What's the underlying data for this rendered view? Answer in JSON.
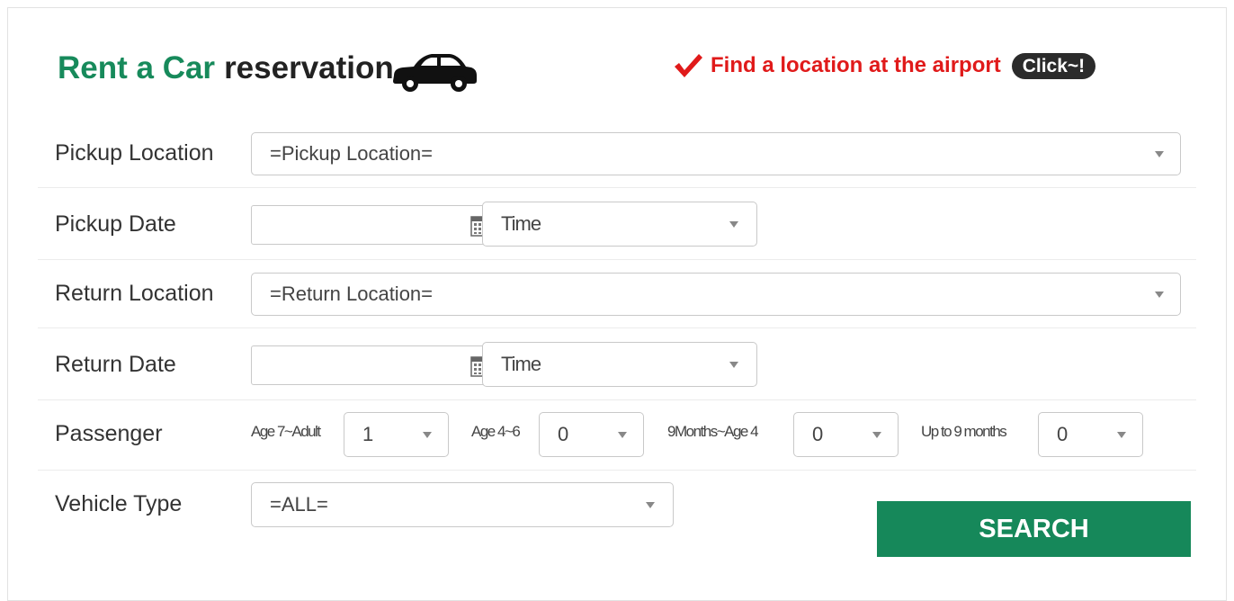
{
  "header": {
    "title_green": "Rent a Car",
    "title_dark": "reservation",
    "car_icon": "car-icon",
    "airport_link": "Find a location at the airport",
    "click_label": "Click~!",
    "check_icon": "checkmark-icon"
  },
  "colors": {
    "brand_green": "#178a5b",
    "alert_red": "#e01a1a",
    "button_green": "#16885a"
  },
  "form": {
    "pickup_location": {
      "label": "Pickup Location",
      "value": "=Pickup Location="
    },
    "pickup_date": {
      "label": "Pickup Date",
      "time_value": "Time"
    },
    "return_location": {
      "label": "Return Location",
      "value": "=Return Location="
    },
    "return_date": {
      "label": "Return Date",
      "time_value": "Time"
    },
    "passenger": {
      "label": "Passenger",
      "groups": [
        {
          "label": "Age 7~Adult",
          "value": "1"
        },
        {
          "label": "Age 4~6",
          "value": "0"
        },
        {
          "label": "9Months~Age 4",
          "value": "0"
        },
        {
          "label": "Up to 9 months",
          "value": "0"
        }
      ]
    },
    "vehicle_type": {
      "label": "Vehicle Type",
      "value": "=ALL="
    },
    "search_label": "SEARCH"
  }
}
